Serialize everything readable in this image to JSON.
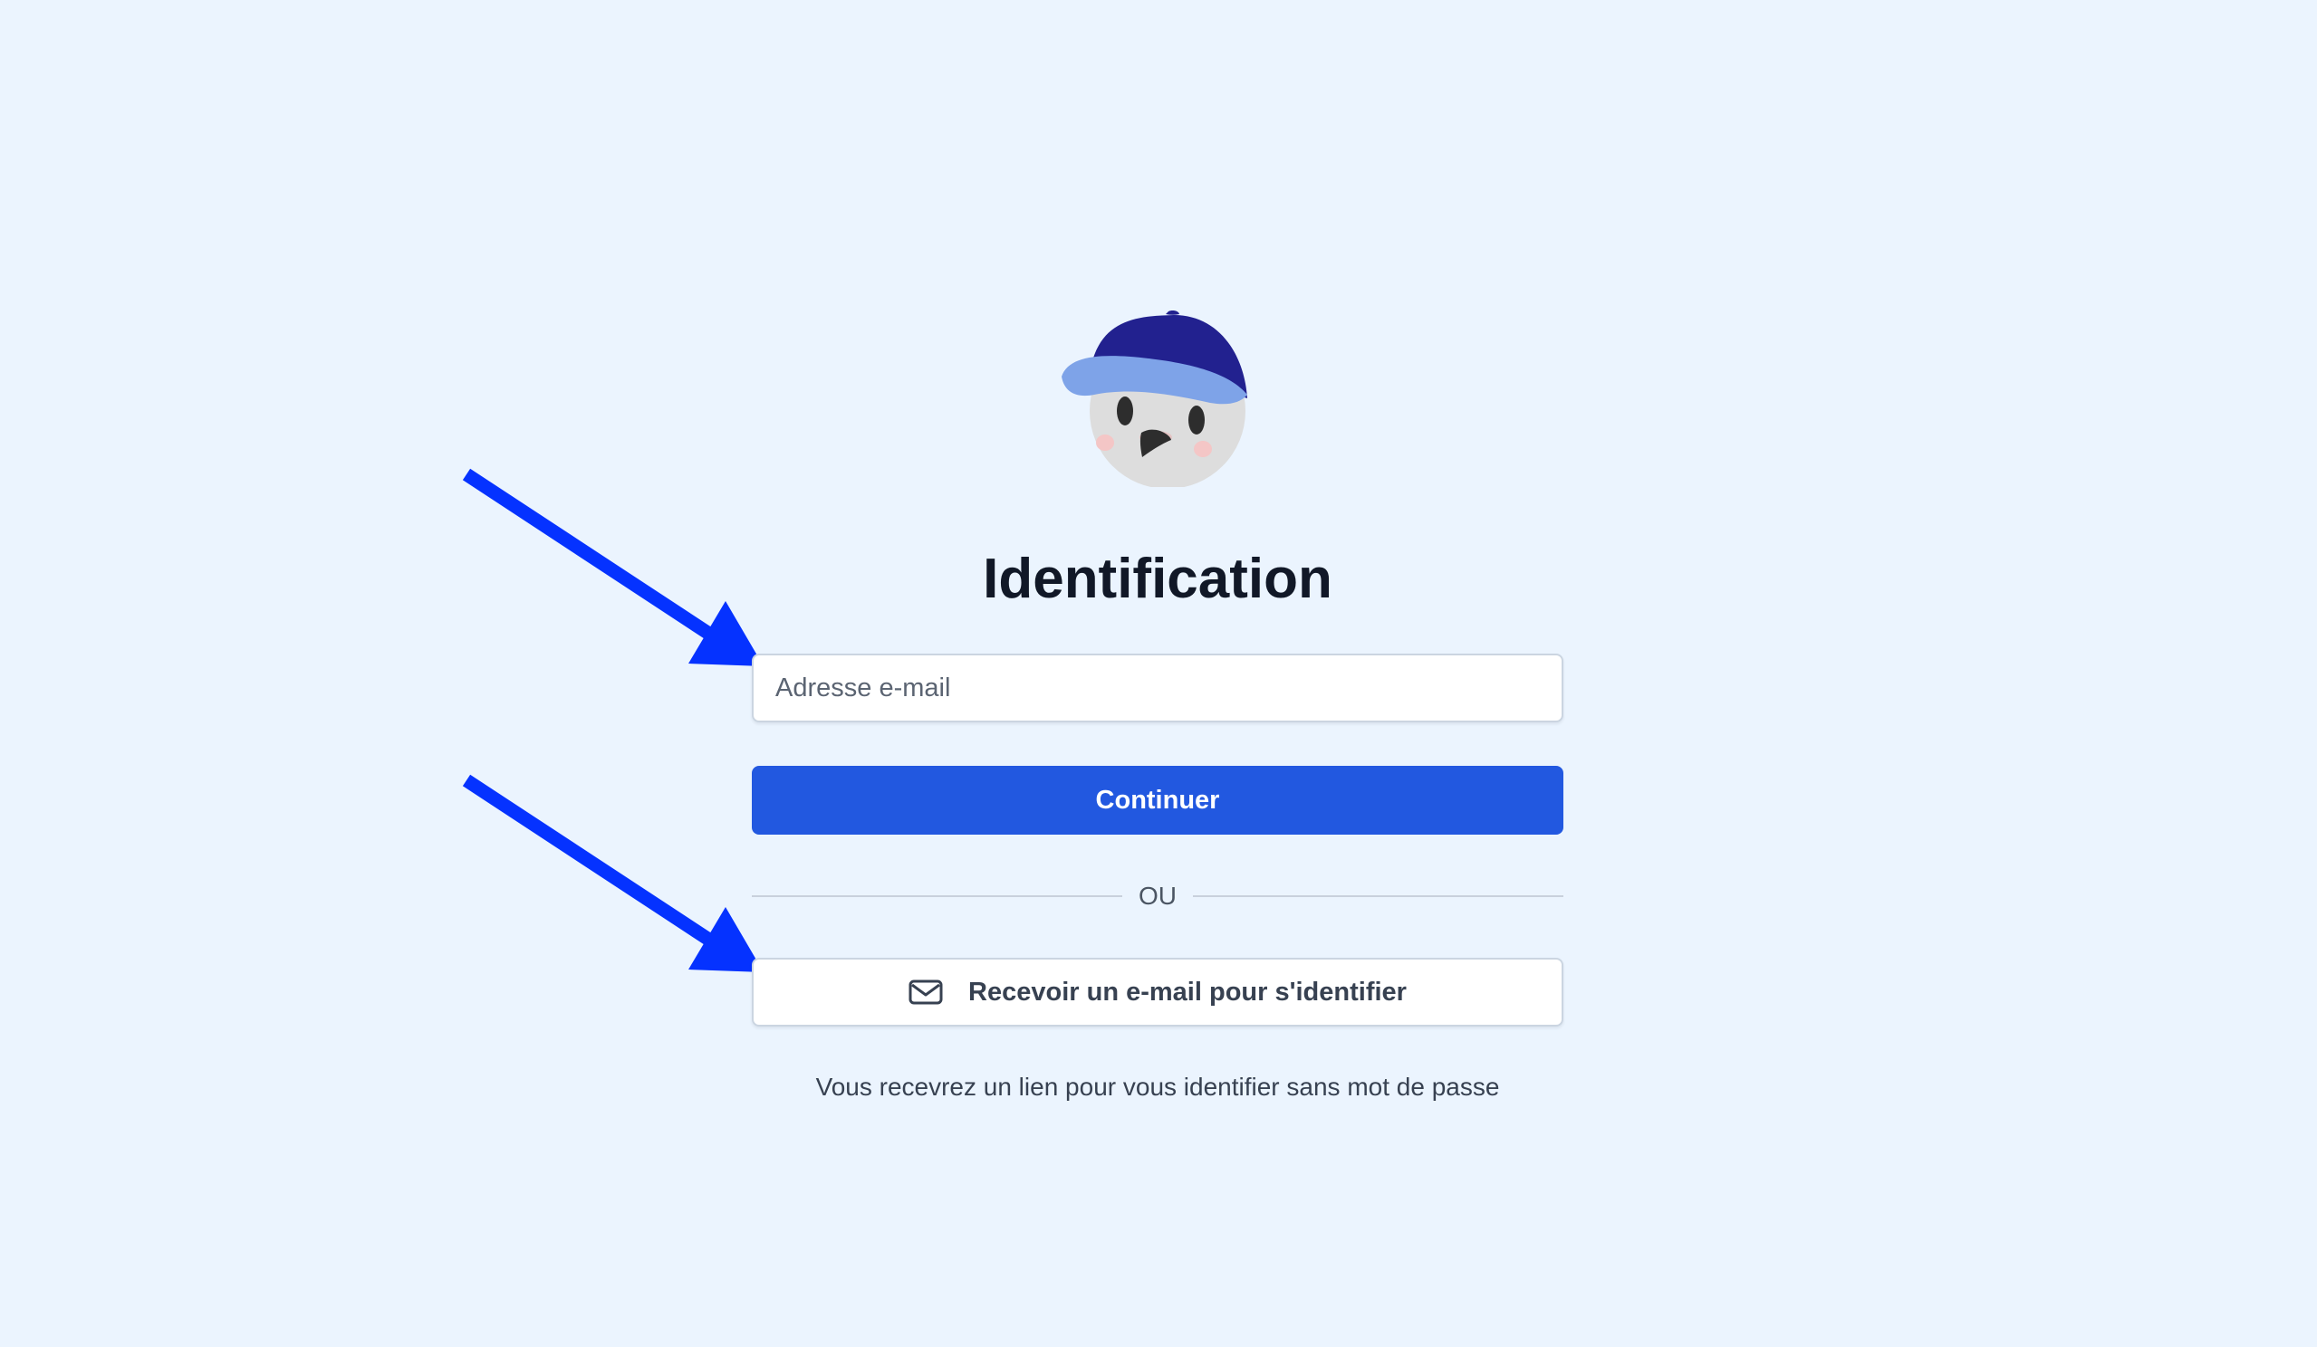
{
  "login": {
    "title": "Identification",
    "email_placeholder": "Adresse e-mail",
    "continue_label": "Continuer",
    "separator_label": "OU",
    "magic_link_label": "Recevoir un e-mail pour s'identifier",
    "helper_text": "Vous recevrez un lien pour vous identifier sans mot de passe"
  },
  "theme": {
    "background": "#ebf4fe",
    "primary": "#2258e0",
    "annotation_arrow": "#0532ff"
  },
  "icons": {
    "logo": "cap-mascot-icon",
    "magic_link": "mail-icon",
    "annotation": "arrow-icon"
  }
}
